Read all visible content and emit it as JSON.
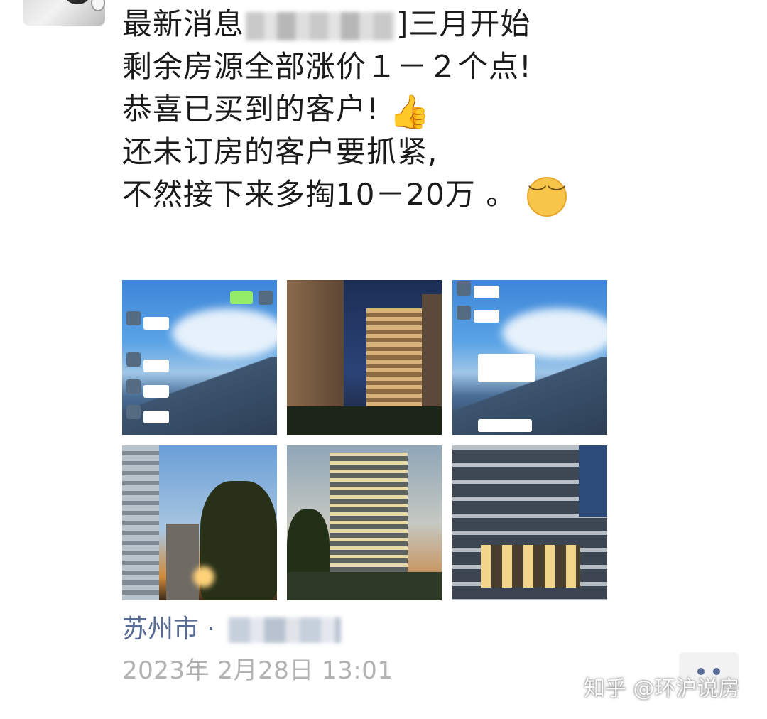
{
  "post": {
    "line1_before": "最新消息",
    "line1_after": "]三月开始",
    "line2": "剩余房源全部涨价１－２个点!",
    "line3": "恭喜已买到的客户!",
    "line4": "还未订房的客户要抓紧,",
    "line5": "不然接下来多掏10－20万 。"
  },
  "emojis": {
    "thumbs_up": "👍",
    "pensive": "︶︶"
  },
  "location": {
    "city": "苏州市",
    "separator": " · "
  },
  "timestamp": "2023年 2月28日 13:01",
  "watermark": "知乎 @环沪说房",
  "colors": {
    "link": "#576b95",
    "timestamp": "#b2b2b2",
    "text": "#1b1b1b"
  },
  "photos": [
    {
      "label": "chat screenshot over mountain sky"
    },
    {
      "label": "high-rise at night"
    },
    {
      "label": "chat screenshot over mountain sky"
    },
    {
      "label": "towers at sunset"
    },
    {
      "label": "building at dusk"
    },
    {
      "label": "lit building facade"
    }
  ]
}
